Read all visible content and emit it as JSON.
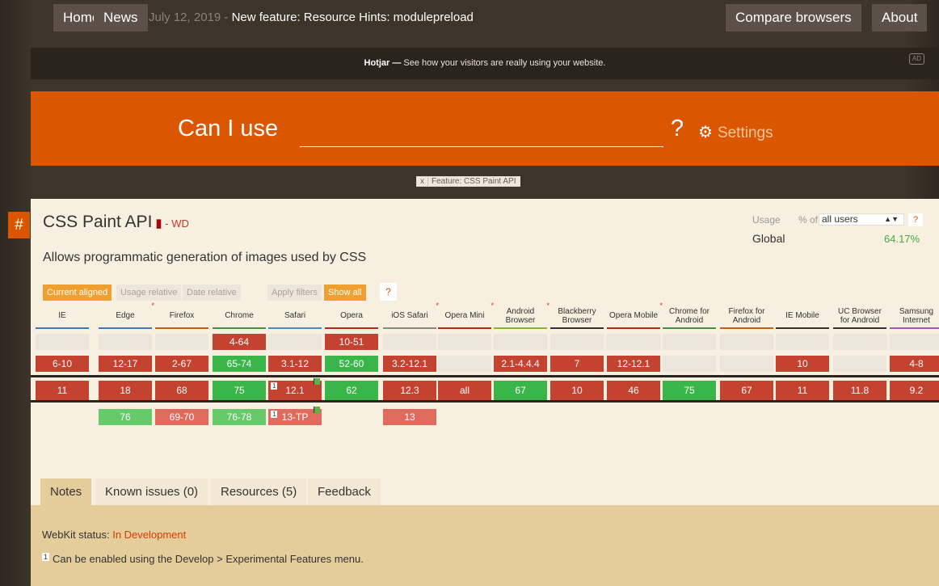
{
  "nav": {
    "home": "Home",
    "news": "News",
    "news_date": "July 12, 2019",
    "news_sep": " - ",
    "news_title": "New feature: Resource Hints: modulepreload",
    "compare": "Compare browsers",
    "about": "About"
  },
  "ad": {
    "brand": "Hotjar",
    "dash": " — ",
    "text": "See how your visitors are really using your website.",
    "badge": "AD"
  },
  "search": {
    "label": "Can I use",
    "qmark": "?",
    "settings": "Settings"
  },
  "filter_chip": {
    "close": "x",
    "label": "Feature: CSS Paint API"
  },
  "feature": {
    "anchor": "#",
    "title": "CSS Paint API",
    "status_sep": " - ",
    "status": "WD",
    "description": "Allows programmatic generation of images used by CSS"
  },
  "usage": {
    "label": "Usage",
    "pct_of": "% of",
    "select_value": "all users",
    "help": "?",
    "region": "Global",
    "value": "64.17%"
  },
  "toolbar": {
    "current_aligned": "Current aligned",
    "usage_relative": "Usage relative",
    "date_relative": "Date relative",
    "apply_filters": "Apply filters",
    "show_all": "Show all",
    "help": "?"
  },
  "browsers": [
    {
      "name": "IE",
      "line2": "",
      "star": false,
      "color": "#3f79b8",
      "cells": [
        "",
        "6-10",
        "11",
        ""
      ]
    },
    {
      "name": "Edge",
      "line2": "",
      "star": true,
      "color": "#3f79b8",
      "cells": [
        "",
        "12-17",
        "18",
        "76"
      ]
    },
    {
      "name": "Firefox",
      "line2": "",
      "star": false,
      "color": "#c25d16",
      "cells": [
        "",
        "2-67",
        "68",
        "69-70"
      ]
    },
    {
      "name": "Chrome",
      "line2": "",
      "star": false,
      "color": "#4c8b48",
      "cells": [
        "4-64",
        "65-74",
        "75",
        "76-78"
      ]
    },
    {
      "name": "Safari",
      "line2": "",
      "star": false,
      "color": "#4f88bd",
      "cells": [
        "",
        "3.1-12",
        "12.1",
        "13-TP"
      ]
    },
    {
      "name": "Opera",
      "line2": "",
      "star": false,
      "color": "#b0291d",
      "cells": [
        "10-51",
        "52-60",
        "62",
        ""
      ]
    },
    {
      "name": "iOS Safari",
      "line2": "",
      "star": true,
      "color": "#888888",
      "cells": [
        "",
        "3.2-12.1",
        "12.3",
        "13"
      ]
    },
    {
      "name": "Opera Mini",
      "line2": "",
      "star": true,
      "color": "#b0291d",
      "cells": [
        "",
        "",
        "all",
        ""
      ]
    },
    {
      "name": "Android",
      "line2": "Browser",
      "star": true,
      "color": "#86b42c",
      "cells": [
        "",
        "2.1-4.4.4",
        "67",
        ""
      ]
    },
    {
      "name": "Blackberry",
      "line2": "Browser",
      "star": false,
      "color": "#333333",
      "cells": [
        "",
        "7",
        "10",
        ""
      ]
    },
    {
      "name": "Opera Mobile",
      "line2": "",
      "star": true,
      "color": "#b0291d",
      "cells": [
        "",
        "12-12.1",
        "46",
        ""
      ]
    },
    {
      "name": "Chrome for",
      "line2": "Android",
      "star": false,
      "color": "#4c8b48",
      "cells": [
        "",
        "",
        "75",
        ""
      ]
    },
    {
      "name": "Firefox for",
      "line2": "Android",
      "star": false,
      "color": "#c25d16",
      "cells": [
        "",
        "",
        "67",
        ""
      ]
    },
    {
      "name": "IE Mobile",
      "line2": "",
      "star": false,
      "color": "#333333",
      "cells": [
        "",
        "10",
        "11",
        ""
      ]
    },
    {
      "name": "UC Browser",
      "line2": "for Android",
      "star": false,
      "color": "#333333",
      "cells": [
        "",
        "",
        "11.8",
        ""
      ]
    },
    {
      "name": "Samsung",
      "line2": "Internet",
      "star": false,
      "color": "#9b59b6",
      "cells": [
        "",
        "4-8",
        "9.2",
        ""
      ]
    }
  ],
  "tabs": [
    "Notes",
    "Known issues (0)",
    "Resources (5)",
    "Feedback"
  ],
  "notes": {
    "webkit_label": "WebKit status:",
    "webkit_value": "In Development",
    "note_num": "1",
    "note_text": "Can be enabled using the Develop > Experimental Features menu."
  }
}
